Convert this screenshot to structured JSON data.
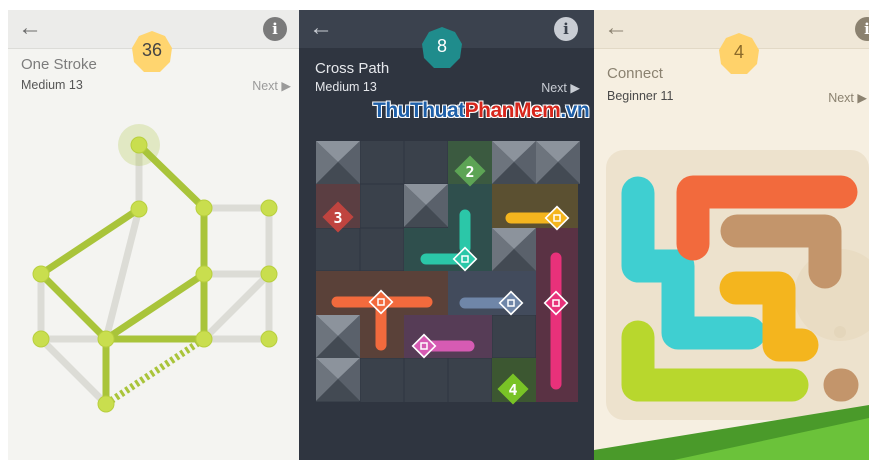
{
  "panels": [
    {
      "title": "One Stroke",
      "level": "Medium 13",
      "next": "Next",
      "moves": "36",
      "back_icon": "arrow-left-icon",
      "info_icon": "info-icon",
      "accent": "#a9c43a"
    },
    {
      "title": "Cross Path",
      "level": "Medium 13",
      "next": "Next",
      "moves": "8",
      "back_icon": "arrow-left-icon",
      "info_icon": "info-icon",
      "accent": "#1f8c8c",
      "tiles": [
        "2",
        "3",
        "4"
      ]
    },
    {
      "title": "Connect",
      "level": "Beginner 11",
      "next": "Next",
      "moves": "4",
      "back_icon": "arrow-left-icon",
      "info_icon": "info-icon",
      "accent": "#ffd26a"
    }
  ],
  "watermark": {
    "part1": "ThuThuat",
    "part2": "PhanMem",
    "part3": ".vn"
  },
  "colors": {
    "orange": "#f26a3d",
    "yellow": "#f4b51e",
    "teal": "#2bc7a8",
    "pink": "#e8317a",
    "slate": "#6f86a8",
    "purple": "#d65bb3",
    "red": "#d2504a",
    "green": "#79c326",
    "cyan": "#3fcfd1",
    "tan": "#c3956b",
    "lime": "#b8d72d"
  }
}
